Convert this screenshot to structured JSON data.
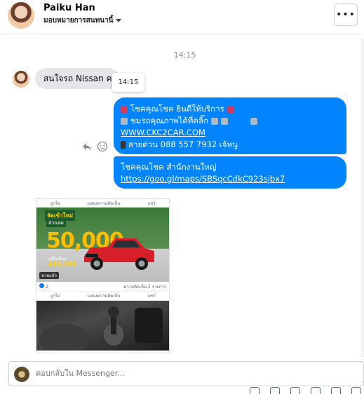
{
  "header": {
    "name": "Paiku Han",
    "assign_label": "มอบหมายการสนทนานี้",
    "more_label": "•••"
  },
  "conversation": {
    "time_separator": "14:15",
    "incoming": {
      "text": "สนใจรถ Nissan ครับ",
      "tooltip_time": "14:15"
    },
    "outgoing_1": {
      "line1": "โชคคุณโชค ยินดีให้บริการ",
      "line2": "ชมรถคุณภาพได้ที่คลิ๊ก",
      "link": "WWW.CKC2CAR.COM",
      "line4": "สายด่วน 088 557 7932 เจ้หนู"
    },
    "outgoing_2": {
      "line1": "โชคคุณโชค สำนักงานใหญ่",
      "link": "https://goo.gl/maps/SBSqcCdkC923sjbx7"
    },
    "shared_post": {
      "bar_like": "ถูกใจ",
      "bar_comment": "แสดงความคิดเห็น",
      "bar_share": "แชร์",
      "promo_top": "จัดเข้าใหม่",
      "promo_sub": "ส่วนลด",
      "promo_big": "50,000",
      "promo_price_label": "เหลือเพียง",
      "promo_price": "299,000",
      "tag": "ขายแล้ว",
      "reaction_count": "2",
      "comment_count": "ความคิดเห็น 2 รายการ"
    }
  },
  "composer": {
    "placeholder": "ตอบกลับใน Messenger..."
  },
  "colors": {
    "accent": "#0084ff",
    "incoming_bubble": "#e4e6eb"
  }
}
